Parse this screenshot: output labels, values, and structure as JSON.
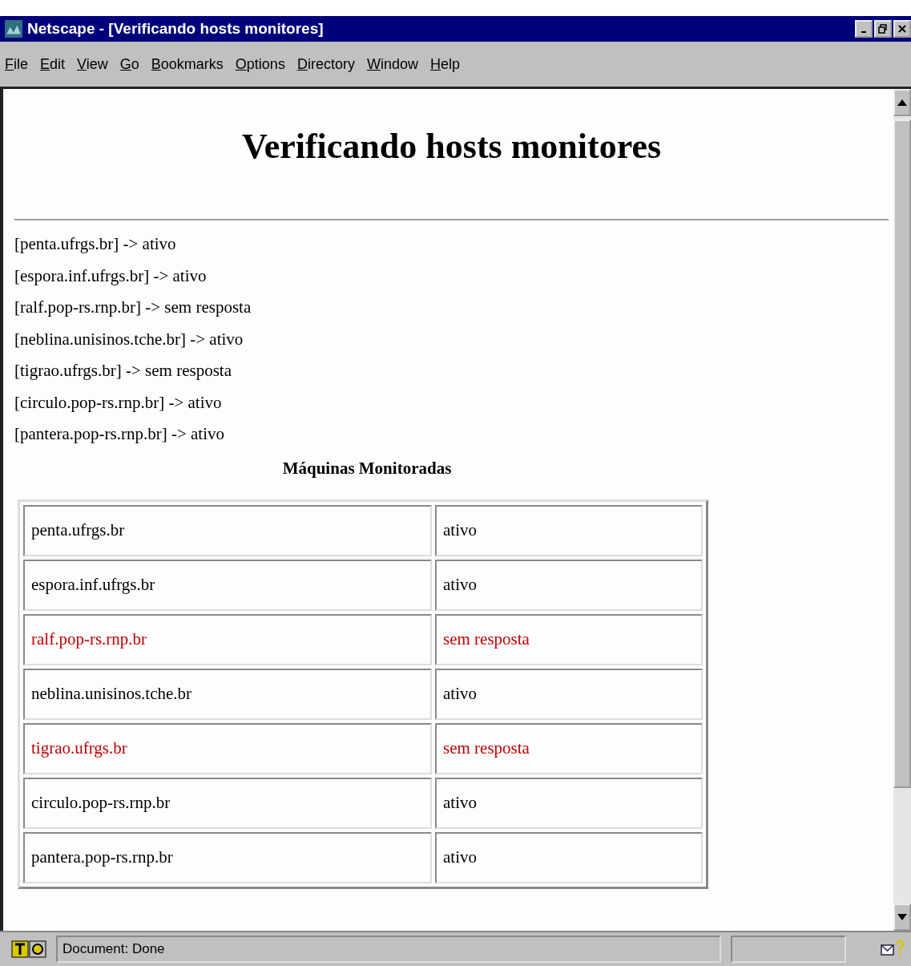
{
  "window": {
    "title": "Netscape - [Verificando hosts monitores]"
  },
  "menu": [
    "File",
    "Edit",
    "View",
    "Go",
    "Bookmarks",
    "Options",
    "Directory",
    "Window",
    "Help"
  ],
  "page": {
    "heading": "Verificando hosts monitores",
    "log": [
      "[penta.ufrgs.br] -> ativo",
      "[espora.inf.ufrgs.br] -> ativo",
      "[ralf.pop-rs.rnp.br] -> sem resposta",
      "[neblina.unisinos.tche.br] -> ativo",
      "[tigrao.ufrgs.br] -> sem resposta",
      "[circulo.pop-rs.rnp.br] -> ativo",
      "[pantera.pop-rs.rnp.br] -> ativo"
    ],
    "table": {
      "caption": "Máquinas Monitoradas",
      "rows": [
        {
          "host": "penta.ufrgs.br",
          "status": "ativo",
          "responding": true
        },
        {
          "host": "espora.inf.ufrgs.br",
          "status": "ativo",
          "responding": true
        },
        {
          "host": "ralf.pop-rs.rnp.br",
          "status": "sem resposta",
          "responding": false
        },
        {
          "host": "neblina.unisinos.tche.br",
          "status": "ativo",
          "responding": true
        },
        {
          "host": "tigrao.ufrgs.br",
          "status": "sem resposta",
          "responding": false
        },
        {
          "host": "circulo.pop-rs.rnp.br",
          "status": "ativo",
          "responding": true
        },
        {
          "host": "pantera.pop-rs.rnp.br",
          "status": "ativo",
          "responding": true
        }
      ]
    }
  },
  "status_bar": {
    "text": "Document: Done"
  }
}
